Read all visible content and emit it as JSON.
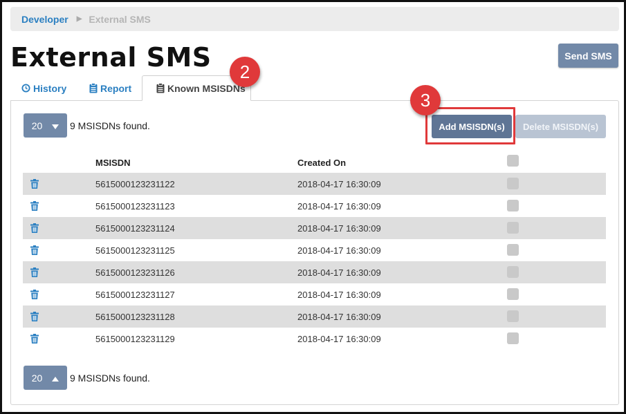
{
  "breadcrumb": {
    "parent": "Developer",
    "current": "External SMS"
  },
  "page": {
    "title": "External SMS",
    "send_button": "Send SMS"
  },
  "tabs": [
    {
      "label": "History",
      "icon": "history-icon"
    },
    {
      "label": "Report",
      "icon": "report-icon"
    },
    {
      "label": "Known MSISDNs",
      "icon": "clipboard-icon",
      "active": true
    }
  ],
  "pager": {
    "top": {
      "value": "20",
      "arrow": "down"
    },
    "bottom": {
      "value": "20",
      "arrow": "up"
    },
    "count_text": "9 MSISDNs found."
  },
  "actions": {
    "add": "Add MSISDN(s)",
    "delete": "Delete MSISDN(s)"
  },
  "table": {
    "columns": [
      "MSISDN",
      "Created On"
    ],
    "rows": [
      {
        "msisdn": "5615000123231122",
        "created": "2018-04-17 16:30:09"
      },
      {
        "msisdn": "5615000123231123",
        "created": "2018-04-17 16:30:09"
      },
      {
        "msisdn": "5615000123231124",
        "created": "2018-04-17 16:30:09"
      },
      {
        "msisdn": "5615000123231125",
        "created": "2018-04-17 16:30:09"
      },
      {
        "msisdn": "5615000123231126",
        "created": "2018-04-17 16:30:09"
      },
      {
        "msisdn": "5615000123231127",
        "created": "2018-04-17 16:30:09"
      },
      {
        "msisdn": "5615000123231128",
        "created": "2018-04-17 16:30:09"
      },
      {
        "msisdn": "5615000123231129",
        "created": "2018-04-17 16:30:09"
      }
    ]
  },
  "annotations": {
    "step2": "2",
    "step3": "3"
  },
  "colors": {
    "accent": "#2a7fc1",
    "button": "#7289a8",
    "highlight": "#e0393a"
  }
}
